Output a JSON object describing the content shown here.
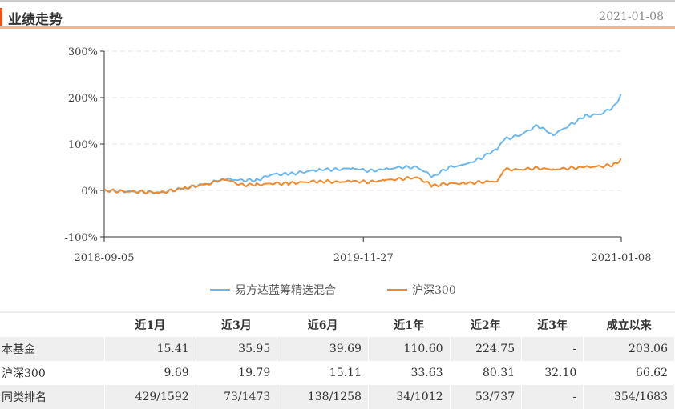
{
  "header": {
    "title": "业绩走势",
    "date": "2021-01-08"
  },
  "chart_data": {
    "type": "line",
    "ylim": [
      -100,
      300
    ],
    "y_ticks": [
      "300%",
      "200%",
      "100%",
      "0%",
      "-100%"
    ],
    "x_ticks": [
      {
        "label": "2018-09-05",
        "day": 0
      },
      {
        "label": "2019-11-27",
        "day": 429
      },
      {
        "label": "2021-01-08",
        "day": 856
      }
    ],
    "grid": true,
    "legend_position": "bottom",
    "series": [
      {
        "name": "易方达蓝筹精选混合",
        "color": "#6cb8ee",
        "points": [
          [
            0,
            0
          ],
          [
            27,
            -2
          ],
          [
            60,
            -3
          ],
          [
            93,
            -5
          ],
          [
            133,
            5
          ],
          [
            173,
            15
          ],
          [
            199,
            25
          ],
          [
            226,
            22
          ],
          [
            252,
            22
          ],
          [
            279,
            35
          ],
          [
            305,
            35
          ],
          [
            332,
            40
          ],
          [
            358,
            45
          ],
          [
            385,
            45
          ],
          [
            411,
            48
          ],
          [
            438,
            42
          ],
          [
            464,
            45
          ],
          [
            491,
            50
          ],
          [
            518,
            50
          ],
          [
            544,
            30
          ],
          [
            571,
            50
          ],
          [
            597,
            55
          ],
          [
            624,
            70
          ],
          [
            650,
            90
          ],
          [
            663,
            110
          ],
          [
            690,
            120
          ],
          [
            717,
            140
          ],
          [
            743,
            120
          ],
          [
            770,
            140
          ],
          [
            796,
            160
          ],
          [
            823,
            165
          ],
          [
            843,
            180
          ],
          [
            856,
            205
          ]
        ]
      },
      {
        "name": "沪深300",
        "color": "#f08a2c",
        "points": [
          [
            0,
            0
          ],
          [
            27,
            -2
          ],
          [
            60,
            -3
          ],
          [
            93,
            -5
          ],
          [
            133,
            5
          ],
          [
            173,
            15
          ],
          [
            199,
            25
          ],
          [
            226,
            12
          ],
          [
            252,
            12
          ],
          [
            279,
            15
          ],
          [
            305,
            15
          ],
          [
            332,
            18
          ],
          [
            358,
            20
          ],
          [
            385,
            18
          ],
          [
            411,
            20
          ],
          [
            438,
            18
          ],
          [
            464,
            22
          ],
          [
            491,
            25
          ],
          [
            518,
            28
          ],
          [
            544,
            10
          ],
          [
            571,
            15
          ],
          [
            597,
            15
          ],
          [
            624,
            18
          ],
          [
            650,
            20
          ],
          [
            663,
            45
          ],
          [
            690,
            45
          ],
          [
            717,
            48
          ],
          [
            743,
            45
          ],
          [
            770,
            48
          ],
          [
            796,
            50
          ],
          [
            823,
            52
          ],
          [
            843,
            55
          ],
          [
            856,
            67
          ]
        ]
      }
    ]
  },
  "table": {
    "headers": [
      "",
      "近1月",
      "近3月",
      "近6月",
      "近1年",
      "近2年",
      "近3年",
      "成立以来"
    ],
    "rows": [
      [
        "本基金",
        "15.41",
        "35.95",
        "39.69",
        "110.60",
        "224.75",
        "-",
        "203.06"
      ],
      [
        "沪深300",
        "9.69",
        "19.79",
        "15.11",
        "33.63",
        "80.31",
        "32.10",
        "66.62"
      ],
      [
        "同类排名",
        "429/1592",
        "73/1473",
        "138/1258",
        "34/1012",
        "53/737",
        "-",
        "354/1683"
      ]
    ]
  }
}
